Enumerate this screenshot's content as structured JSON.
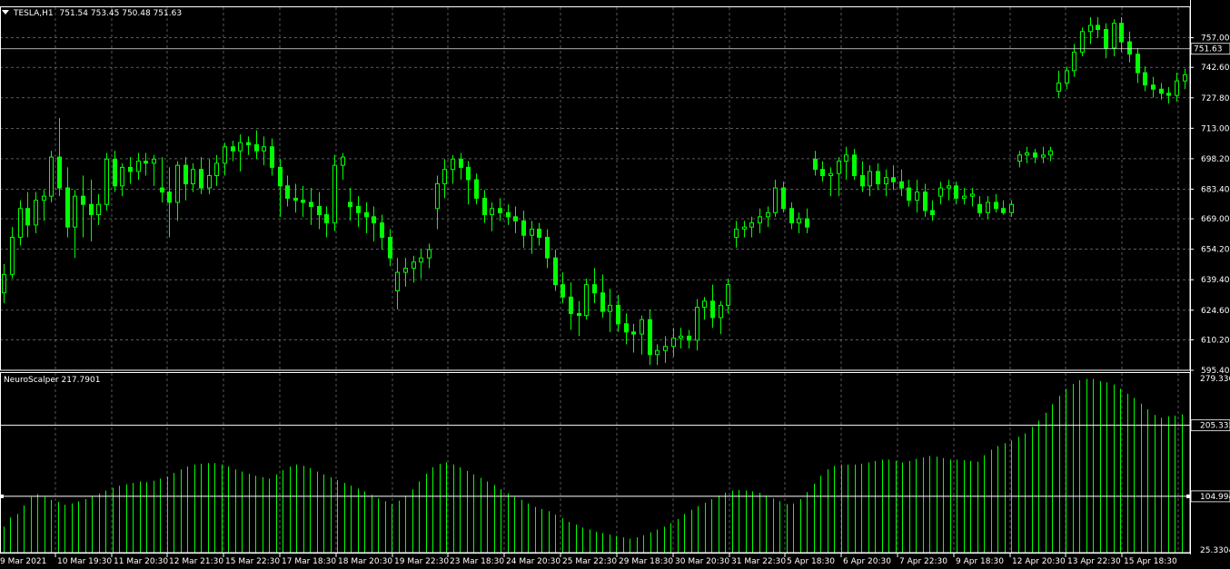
{
  "symbol_header": {
    "dropdown_icon": "triangle-down-icon",
    "symbol": "TESLA,H1",
    "ohlc": "751.54 753.45 750.48 751.63"
  },
  "indicator_header": {
    "label": "NeuroScalper 217.7901"
  },
  "colors": {
    "background": "#000000",
    "grid": "#c0c0c0",
    "bull": "#00ff00",
    "bear": "#00ff00",
    "histogram": "#00ff00",
    "level_line": "#ffffff",
    "text": "#ffffff"
  },
  "price_axis": {
    "ticks": [
      "757.00",
      "742.60",
      "727.80",
      "713.00",
      "698.20",
      "683.40",
      "669.00",
      "654.20",
      "639.40",
      "624.60",
      "610.20",
      "595.40"
    ],
    "current_price_label": "751.63"
  },
  "indicator_axis": {
    "ticks": [
      "279.336",
      "205.335",
      "104.994",
      "25.3304"
    ]
  },
  "time_axis": {
    "labels": [
      "9 Mar 2021",
      "10 Mar 19:30",
      "11 Mar 20:30",
      "12 Mar 21:30",
      "15 Mar 22:30",
      "17 Mar 18:30",
      "18 Mar 20:30",
      "19 Mar 22:30",
      "23 Mar 18:30",
      "24 Mar 20:30",
      "25 Mar 22:30",
      "29 Mar 18:30",
      "30 Mar 20:30",
      "31 Mar 22:30",
      "5 Apr 18:30",
      "6 Apr 20:30",
      "7 Apr 22:30",
      "9 Apr 18:30",
      "12 Apr 20:30",
      "13 Apr 22:30",
      "15 Apr 18:30"
    ]
  },
  "chart_data": {
    "type": "candlestick",
    "symbol": "TESLA",
    "timeframe": "H1",
    "price_range": [
      595.4,
      771.8
    ],
    "last_price": 751.63,
    "candles": [
      [
        633,
        647,
        628,
        642
      ],
      [
        642,
        665,
        640,
        660
      ],
      [
        660,
        678,
        656,
        674
      ],
      [
        674,
        682,
        660,
        666
      ],
      [
        666,
        682,
        662,
        678
      ],
      [
        678,
        683,
        668,
        680
      ],
      [
        680,
        702,
        677,
        699
      ],
      [
        699,
        718,
        680,
        684
      ],
      [
        684,
        694,
        660,
        665
      ],
      [
        665,
        683,
        650,
        680
      ],
      [
        680,
        690,
        660,
        676
      ],
      [
        676,
        688,
        658,
        671
      ],
      [
        671,
        681,
        666,
        676
      ],
      [
        676,
        701,
        673,
        698
      ],
      [
        698,
        702,
        682,
        685
      ],
      [
        685,
        696,
        680,
        694
      ],
      [
        694,
        699,
        686,
        692
      ],
      [
        692,
        701,
        688,
        697
      ],
      [
        697,
        701,
        690,
        696
      ],
      [
        696,
        700,
        685,
        698
      ],
      [
        684,
        699,
        677,
        682
      ],
      [
        682,
        694,
        660,
        677
      ],
      [
        677,
        697,
        668,
        695
      ],
      [
        695,
        699,
        678,
        686
      ],
      [
        686,
        696,
        682,
        693
      ],
      [
        693,
        699,
        681,
        684
      ],
      [
        684,
        698,
        681,
        690
      ],
      [
        690,
        700,
        685,
        696
      ],
      [
        696,
        706,
        690,
        704
      ],
      [
        704,
        707,
        697,
        702
      ],
      [
        702,
        710,
        692,
        706
      ],
      [
        706,
        709,
        700,
        705
      ],
      [
        705,
        712,
        698,
        702
      ],
      [
        702,
        709,
        695,
        704
      ],
      [
        704,
        708,
        690,
        694
      ],
      [
        694,
        698,
        670,
        685
      ],
      [
        685,
        690,
        675,
        679
      ],
      [
        679,
        686,
        672,
        678
      ],
      [
        678,
        685,
        670,
        677
      ],
      [
        677,
        684,
        666,
        675
      ],
      [
        675,
        682,
        664,
        671
      ],
      [
        671,
        675,
        660,
        667
      ],
      [
        667,
        700,
        663,
        695
      ],
      [
        695,
        701,
        688,
        699
      ],
      [
        677,
        684,
        668,
        675
      ],
      [
        675,
        680,
        665,
        672
      ],
      [
        672,
        677,
        662,
        670
      ],
      [
        670,
        675,
        658,
        667
      ],
      [
        667,
        671,
        654,
        660
      ],
      [
        660,
        664,
        646,
        650
      ],
      [
        634,
        650,
        625,
        643
      ],
      [
        643,
        650,
        636,
        645
      ],
      [
        645,
        651,
        638,
        648
      ],
      [
        648,
        654,
        640,
        650
      ],
      [
        650,
        657,
        645,
        654
      ],
      [
        674,
        690,
        664,
        686
      ],
      [
        686,
        698,
        679,
        693
      ],
      [
        693,
        700,
        686,
        698
      ],
      [
        698,
        701,
        688,
        694
      ],
      [
        694,
        697,
        676,
        688
      ],
      [
        688,
        691,
        676,
        679
      ],
      [
        679,
        683,
        667,
        671
      ],
      [
        671,
        677,
        663,
        674
      ],
      [
        674,
        679,
        668,
        672
      ],
      [
        672,
        676,
        666,
        670
      ],
      [
        670,
        675,
        662,
        668
      ],
      [
        668,
        673,
        655,
        661
      ],
      [
        661,
        668,
        652,
        664
      ],
      [
        664,
        667,
        656,
        660
      ],
      [
        660,
        664,
        645,
        650
      ],
      [
        650,
        654,
        634,
        637
      ],
      [
        637,
        643,
        628,
        631
      ],
      [
        631,
        638,
        615,
        623
      ],
      [
        623,
        629,
        612,
        622
      ],
      [
        622,
        640,
        620,
        637
      ],
      [
        637,
        645,
        628,
        633
      ],
      [
        633,
        642,
        621,
        624
      ],
      [
        624,
        635,
        614,
        627
      ],
      [
        627,
        632,
        614,
        618
      ],
      [
        618,
        623,
        608,
        614
      ],
      [
        614,
        618,
        604,
        613
      ],
      [
        613,
        622,
        603,
        620
      ],
      [
        620,
        625,
        598,
        603
      ],
      [
        603,
        608,
        598,
        605
      ],
      [
        605,
        612,
        599,
        607
      ],
      [
        607,
        616,
        602,
        611
      ],
      [
        611,
        616,
        606,
        612
      ],
      [
        612,
        615,
        606,
        610
      ],
      [
        610,
        630,
        605,
        626
      ],
      [
        626,
        631,
        620,
        629
      ],
      [
        629,
        637,
        616,
        621
      ],
      [
        621,
        629,
        613,
        627
      ],
      [
        627,
        640,
        623,
        637
      ],
      [
        660,
        668,
        655,
        664
      ],
      [
        664,
        668,
        660,
        665
      ],
      [
        665,
        670,
        660,
        667
      ],
      [
        667,
        674,
        662,
        670
      ],
      [
        670,
        675,
        665,
        672
      ],
      [
        672,
        688,
        670,
        684
      ],
      [
        684,
        687,
        672,
        674
      ],
      [
        674,
        677,
        664,
        667
      ],
      [
        667,
        672,
        662,
        669
      ],
      [
        669,
        674,
        662,
        665
      ],
      [
        698,
        702,
        690,
        693
      ],
      [
        693,
        697,
        687,
        690
      ],
      [
        690,
        694,
        680,
        691
      ],
      [
        691,
        699,
        680,
        697
      ],
      [
        697,
        704,
        688,
        700
      ],
      [
        700,
        703,
        688,
        690
      ],
      [
        690,
        697,
        682,
        685
      ],
      [
        685,
        695,
        680,
        692
      ],
      [
        692,
        696,
        683,
        686
      ],
      [
        686,
        693,
        680,
        689
      ],
      [
        689,
        695,
        683,
        687
      ],
      [
        687,
        693,
        680,
        684
      ],
      [
        684,
        688,
        675,
        678
      ],
      [
        678,
        688,
        672,
        682
      ],
      [
        682,
        686,
        670,
        673
      ],
      [
        673,
        678,
        668,
        671
      ],
      [
        680,
        687,
        676,
        684
      ],
      [
        684,
        688,
        678,
        685
      ],
      [
        685,
        687,
        676,
        679
      ],
      [
        679,
        684,
        676,
        680
      ],
      [
        680,
        684,
        675,
        681
      ],
      [
        676,
        680,
        670,
        672
      ],
      [
        672,
        680,
        669,
        677
      ],
      [
        677,
        681,
        672,
        674
      ],
      [
        674,
        678,
        671,
        672
      ],
      [
        672,
        678,
        670,
        676
      ],
      [
        697,
        702,
        694,
        700
      ],
      [
        700,
        704,
        696,
        701
      ],
      [
        701,
        703,
        696,
        699
      ],
      [
        699,
        704,
        696,
        700
      ],
      [
        700,
        704,
        697,
        702
      ],
      [
        731,
        741,
        728,
        735
      ],
      [
        735,
        743,
        732,
        741
      ],
      [
        741,
        754,
        738,
        750
      ],
      [
        750,
        762,
        748,
        760
      ],
      [
        760,
        767,
        754,
        763
      ],
      [
        763,
        767,
        757,
        761
      ],
      [
        761,
        764,
        747,
        752
      ],
      [
        752,
        766,
        748,
        764
      ],
      [
        764,
        767,
        750,
        755
      ],
      [
        755,
        760,
        745,
        749
      ],
      [
        749,
        752,
        735,
        740
      ],
      [
        740,
        743,
        731,
        734
      ],
      [
        734,
        738,
        728,
        732
      ],
      [
        732,
        735,
        727,
        730
      ],
      [
        730,
        733,
        725,
        729
      ],
      [
        729,
        740,
        726,
        736
      ],
      [
        736,
        742,
        732,
        739
      ]
    ],
    "neuroscalper": {
      "name": "NeuroScalper",
      "value": 217.7901,
      "range": [
        25.3304,
        279.336
      ],
      "levels": [
        205.335,
        104.994
      ],
      "values": [
        62,
        75,
        80,
        92,
        104,
        108,
        104,
        100,
        97,
        93,
        95,
        98,
        101,
        105,
        109,
        113,
        117,
        120,
        122,
        124,
        126,
        125,
        127,
        130,
        133,
        138,
        143,
        147,
        150,
        151,
        152,
        152,
        150,
        147,
        143,
        140,
        137,
        134,
        132,
        130,
        136,
        142,
        147,
        150,
        148,
        145,
        140,
        136,
        132,
        128,
        124,
        120,
        116,
        112,
        107,
        102,
        98,
        94,
        99,
        106,
        115,
        126,
        137,
        146,
        151,
        153,
        150,
        146,
        141,
        136,
        131,
        126,
        121,
        115,
        109,
        104,
        100,
        95,
        90,
        87,
        84,
        79,
        74,
        69,
        65,
        61,
        58,
        55,
        53,
        51,
        49,
        47,
        45,
        47,
        50,
        54,
        58,
        62,
        67,
        73,
        80,
        86,
        91,
        96,
        101,
        106,
        110,
        113,
        114,
        113,
        112,
        110,
        106,
        102,
        98,
        94,
        95,
        101,
        111,
        123,
        134,
        143,
        148,
        150,
        150,
        150,
        151,
        153,
        155,
        157,
        157,
        155,
        153,
        155,
        158,
        160,
        162,
        161,
        159,
        157,
        157,
        156,
        155,
        154,
        163,
        171,
        176,
        180,
        184,
        189,
        194,
        203,
        212,
        223,
        235,
        247,
        257,
        264,
        269,
        271,
        271,
        268,
        266,
        263,
        257,
        250,
        244,
        236,
        228,
        220,
        216,
        218,
        219,
        221
      ]
    }
  }
}
